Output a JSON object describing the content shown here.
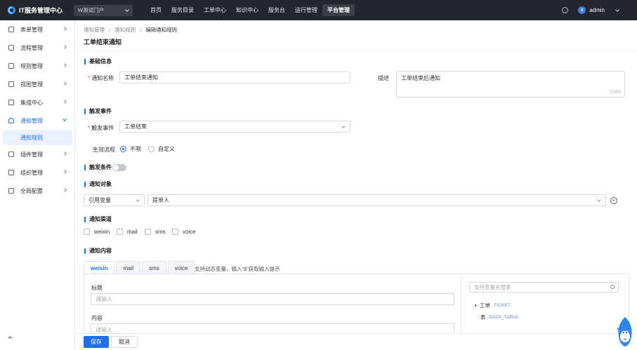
{
  "topbar": {
    "app_title": "IT服务管理中心",
    "tenant": "W测试门户",
    "nav": [
      "首页",
      "服务目录",
      "工单中心",
      "知识中心",
      "服务台",
      "运行管理",
      "平台管理"
    ],
    "active_nav": "平台管理",
    "avatar_letter": "a",
    "username": "admin"
  },
  "sidebar": {
    "items": [
      {
        "label": "表单管理",
        "icon": "form-icon"
      },
      {
        "label": "流程管理",
        "icon": "process-icon"
      },
      {
        "label": "规则管理",
        "icon": "rule-icon"
      },
      {
        "label": "视图管理",
        "icon": "view-icon"
      },
      {
        "label": "集成中心",
        "icon": "integration-icon"
      },
      {
        "label": "通知管理",
        "icon": "bell-icon",
        "open": true
      },
      {
        "label": "插件管理",
        "icon": "plugin-icon"
      },
      {
        "label": "组织管理",
        "icon": "org-icon"
      },
      {
        "label": "全局配置",
        "icon": "settings-icon"
      }
    ],
    "sub_item": "通知规则",
    "collapse_glyph": "⇤"
  },
  "breadcrumb": {
    "items": [
      "通知管理",
      "通知规则",
      "编辑通知规则"
    ],
    "sep": "/"
  },
  "page_title": "工单结束通知",
  "basic": {
    "section": "基础信息",
    "name_required": "*",
    "name_label": "通知名称",
    "name_value": "工单结束通知",
    "desc_label": "描述",
    "desc_value": "工单结束后通知",
    "desc_counter": "7/255"
  },
  "trigger": {
    "section": "触发事件",
    "event_required": "*",
    "event_label": "触发事件",
    "event_value": "工单结束",
    "flow_label": "生效流程",
    "flow_options": [
      "不限",
      "自定义"
    ],
    "flow_selected": "不限"
  },
  "condition": {
    "section": "触发条件",
    "enabled": false
  },
  "target": {
    "section": "通知对象",
    "type_value": "引用变量",
    "value": "提单人",
    "add_glyph": "+"
  },
  "channels": {
    "section": "通知渠道",
    "options": [
      "weixin",
      "mail",
      "sms",
      "voice"
    ]
  },
  "content": {
    "section": "通知内容",
    "tabs": [
      "weixin",
      "mail",
      "sms",
      "voice"
    ],
    "active_tab": "weixin",
    "hint": "支持动态变量，输入“$”获取输入提示",
    "title_label": "标题",
    "title_placeholder": "请输入",
    "body_label": "内容",
    "body_placeholder": "请输入",
    "var_search_placeholder": "支持变量名搜索",
    "tree": [
      {
        "expand": "▸",
        "label": "工单",
        "code": "TICKET"
      },
      {
        "expand": "",
        "label": "表",
        "code": "DATA_TABLE"
      }
    ]
  },
  "footer": {
    "save": "保存",
    "cancel": "取消"
  },
  "colors": {
    "primary": "#1e6fe8",
    "topbar": "#22262e",
    "required": "#e34d4d"
  }
}
